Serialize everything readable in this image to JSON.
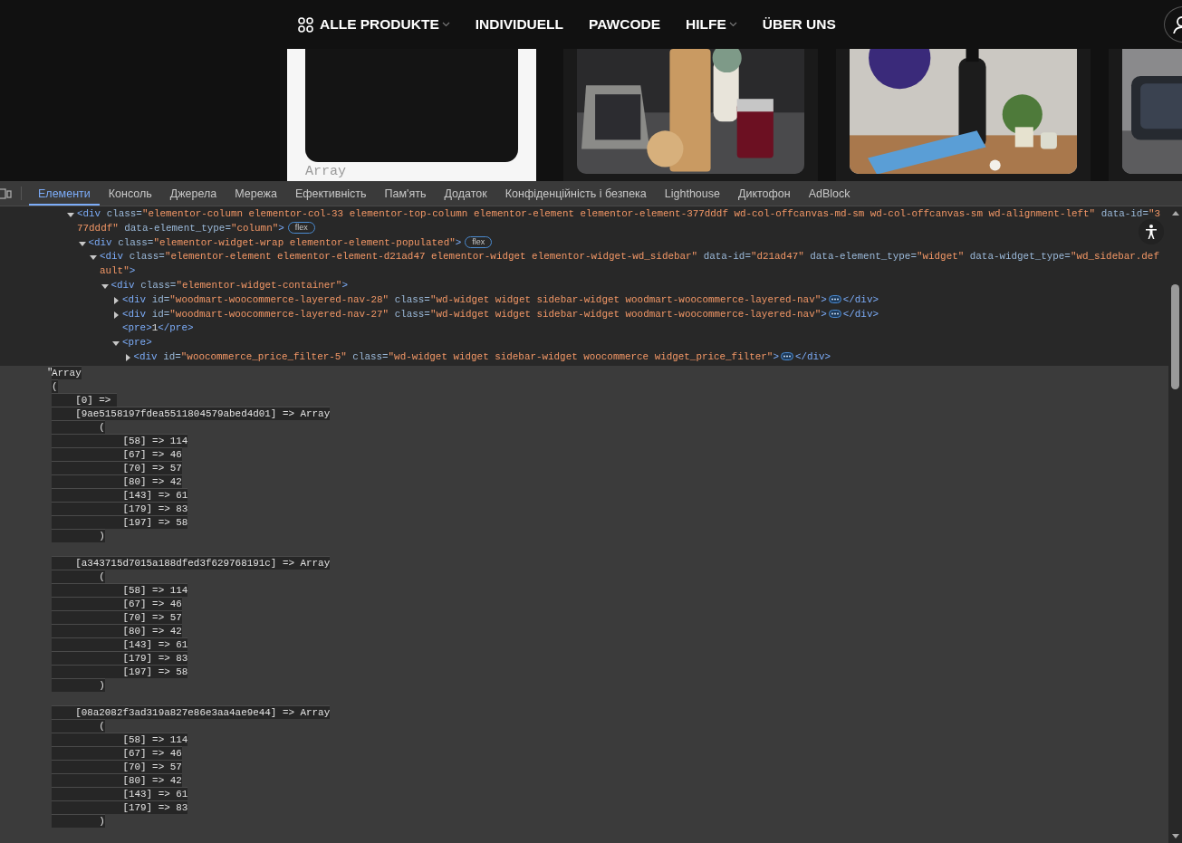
{
  "nav": {
    "items": [
      {
        "label": "ALLE PRODUKTE",
        "grid_icon": true,
        "dropdown": true
      },
      {
        "label": "INDIVIDUELL",
        "grid_icon": false,
        "dropdown": false
      },
      {
        "label": "PAWCODE",
        "grid_icon": false,
        "dropdown": false
      },
      {
        "label": "HILFE",
        "grid_icon": false,
        "dropdown": true
      },
      {
        "label": "ÜBER UNS",
        "grid_icon": false,
        "dropdown": false
      }
    ]
  },
  "products": {
    "card_text": "Array"
  },
  "devtools": {
    "tabs": [
      {
        "label": "Елементи",
        "selected": true
      },
      {
        "label": "Консоль",
        "selected": false
      },
      {
        "label": "Джерела",
        "selected": false
      },
      {
        "label": "Мережа",
        "selected": false
      },
      {
        "label": "Ефективність",
        "selected": false
      },
      {
        "label": "Пам'ять",
        "selected": false
      },
      {
        "label": "Додаток",
        "selected": false
      },
      {
        "label": "Конфіденційність і безпека",
        "selected": false
      },
      {
        "label": "Lighthouse",
        "selected": false
      },
      {
        "label": "Диктофон",
        "selected": false
      },
      {
        "label": "AdBlock",
        "selected": false
      }
    ],
    "dom": [
      {
        "kind": "element",
        "expanded": true,
        "badge": "flex",
        "tokens": [
          {
            "kind": "tag",
            "t": "<div"
          },
          {
            "kind": "attr",
            "t": " class="
          },
          {
            "kind": "val",
            "t": "\"elementor-column elementor-col-33 elementor-top-column elementor-element elementor-element-377dddf wd-col-offcanvas-md-sm wd-col-offcanvas-sm wd-alignment-left\""
          },
          {
            "kind": "attr",
            "t": " data-id="
          },
          {
            "kind": "val",
            "t": "\"377dddf\""
          },
          {
            "kind": "attr",
            "t": " data-element_type="
          },
          {
            "kind": "val",
            "t": "\"column\""
          },
          {
            "kind": "tag",
            "t": ">"
          }
        ],
        "children": [
          {
            "kind": "element",
            "expanded": true,
            "badge": "flex",
            "tokens": [
              {
                "kind": "tag",
                "t": "<div"
              },
              {
                "kind": "attr",
                "t": " class="
              },
              {
                "kind": "val",
                "t": "\"elementor-widget-wrap elementor-element-populated\""
              },
              {
                "kind": "tag",
                "t": ">"
              }
            ],
            "children": [
              {
                "kind": "element",
                "expanded": true,
                "tokens": [
                  {
                    "kind": "tag",
                    "t": "<div"
                  },
                  {
                    "kind": "attr",
                    "t": " class="
                  },
                  {
                    "kind": "val",
                    "t": "\"elementor-element elementor-element-d21ad47 elementor-widget elementor-widget-wd_sidebar\""
                  },
                  {
                    "kind": "attr",
                    "t": " data-id="
                  },
                  {
                    "kind": "val",
                    "t": "\"d21ad47\""
                  },
                  {
                    "kind": "attr",
                    "t": " data-element_type="
                  },
                  {
                    "kind": "val",
                    "t": "\"widget\""
                  },
                  {
                    "kind": "attr",
                    "t": " data-widget_type="
                  },
                  {
                    "kind": "val",
                    "t": "\"wd_sidebar.default\""
                  },
                  {
                    "kind": "tag",
                    "t": ">"
                  }
                ],
                "children": [
                  {
                    "kind": "element",
                    "expanded": true,
                    "tokens": [
                      {
                        "kind": "tag",
                        "t": "<div"
                      },
                      {
                        "kind": "attr",
                        "t": " class="
                      },
                      {
                        "kind": "val",
                        "t": "\"elementor-widget-container\""
                      },
                      {
                        "kind": "tag",
                        "t": ">"
                      }
                    ],
                    "children": [
                      {
                        "kind": "element",
                        "expanded": false,
                        "ellipsis": true,
                        "tokens": [
                          {
                            "kind": "tag",
                            "t": "<div"
                          },
                          {
                            "kind": "attr",
                            "t": " id="
                          },
                          {
                            "kind": "val",
                            "t": "\"woodmart-woocommerce-layered-nav-28\""
                          },
                          {
                            "kind": "attr",
                            "t": " class="
                          },
                          {
                            "kind": "val",
                            "t": "\"wd-widget widget sidebar-widget woodmart-woocommerce-layered-nav\""
                          },
                          {
                            "kind": "tag",
                            "t": ">"
                          }
                        ],
                        "tail": "</div>"
                      },
                      {
                        "kind": "element",
                        "expanded": false,
                        "ellipsis": true,
                        "tokens": [
                          {
                            "kind": "tag",
                            "t": "<div"
                          },
                          {
                            "kind": "attr",
                            "t": " id="
                          },
                          {
                            "kind": "val",
                            "t": "\"woodmart-woocommerce-layered-nav-27\""
                          },
                          {
                            "kind": "attr",
                            "t": " class="
                          },
                          {
                            "kind": "val",
                            "t": "\"wd-widget widget sidebar-widget woodmart-woocommerce-layered-nav\""
                          },
                          {
                            "kind": "tag",
                            "t": ">"
                          }
                        ],
                        "tail": "</div>"
                      },
                      {
                        "kind": "inline",
                        "tokens": [
                          {
                            "kind": "tag",
                            "t": "<pre>"
                          },
                          {
                            "kind": "text",
                            "t": "1"
                          },
                          {
                            "kind": "tag",
                            "t": "</pre>"
                          }
                        ]
                      },
                      {
                        "kind": "element",
                        "expanded": true,
                        "tokens": [
                          {
                            "kind": "tag",
                            "t": "<pre>"
                          }
                        ],
                        "children": [
                          {
                            "kind": "element",
                            "expanded": false,
                            "ellipsis": true,
                            "tokens": [
                              {
                                "kind": "tag",
                                "t": "<div"
                              },
                              {
                                "kind": "attr",
                                "t": " id="
                              },
                              {
                                "kind": "val",
                                "t": "\"woocommerce_price_filter-5\""
                              },
                              {
                                "kind": "attr",
                                "t": " class="
                              },
                              {
                                "kind": "val",
                                "t": "\"wd-widget widget sidebar-widget woocommerce widget_price_filter\""
                              },
                              {
                                "kind": "tag",
                                "t": ">"
                              }
                            ],
                            "tail": "</div>"
                          },
                          {
                            "kind": "text",
                            "quote": "\"",
                            "blocks": [
                              [
                                "Array",
                                "(",
                                "    [0] => ",
                                "    [9ae5158197fdea5511804579abed4d01] => Array",
                                "        (",
                                "            [58] => 114",
                                "            [67] => 46",
                                "            [70] => 57",
                                "            [80] => 42",
                                "            [143] => 61",
                                "            [179] => 83",
                                "            [197] => 58",
                                "        )"
                              ],
                              [
                                "    [a343715d7015a188dfed3f629768191c] => Array",
                                "        (",
                                "            [58] => 114",
                                "            [67] => 46",
                                "            [70] => 57",
                                "            [80] => 42",
                                "            [143] => 61",
                                "            [179] => 83",
                                "            [197] => 58",
                                "        )"
                              ],
                              [
                                "    [08a2082f3ad319a827e86e3aa4ae9e44] => Array",
                                "        (",
                                "            [58] => 114",
                                "            [67] => 46",
                                "            [70] => 57",
                                "            [80] => 42",
                                "            [143] => 61",
                                "            [179] => 83",
                                "        )"
                              ]
                            ]
                          }
                        ]
                      }
                    ]
                  }
                ]
              }
            ]
          }
        ]
      }
    ]
  }
}
